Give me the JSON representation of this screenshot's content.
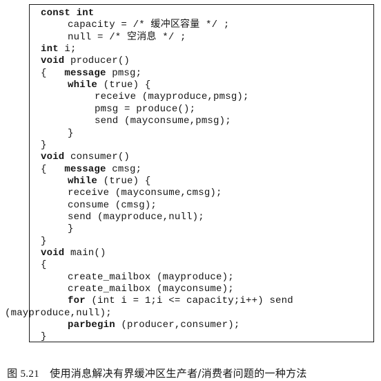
{
  "code": {
    "lines": [
      {
        "indent": 0,
        "segments": [
          {
            "text": "const int",
            "bold": true
          }
        ]
      },
      {
        "indent": 2,
        "segments": [
          {
            "text": "capacity = /* 缓冲区容量 */ ;",
            "bold": false
          }
        ]
      },
      {
        "indent": 2,
        "segments": [
          {
            "text": "null = /* 空消息 */ ;",
            "bold": false
          }
        ]
      },
      {
        "indent": 0,
        "segments": [
          {
            "text": "int",
            "bold": true
          },
          {
            "text": " i;",
            "bold": false
          }
        ]
      },
      {
        "indent": 0,
        "segments": [
          {
            "text": "void",
            "bold": true
          },
          {
            "text": " producer()",
            "bold": false
          }
        ]
      },
      {
        "indent": 0,
        "segments": [
          {
            "text": "{   ",
            "bold": false
          },
          {
            "text": "message",
            "bold": true
          },
          {
            "text": " pmsg;",
            "bold": false
          }
        ]
      },
      {
        "indent": 2,
        "segments": [
          {
            "text": "while",
            "bold": true
          },
          {
            "text": " (true) {",
            "bold": false
          }
        ]
      },
      {
        "indent": 4,
        "segments": [
          {
            "text": "receive (mayproduce,pmsg);",
            "bold": false
          }
        ]
      },
      {
        "indent": 4,
        "segments": [
          {
            "text": "pmsg = produce();",
            "bold": false
          }
        ]
      },
      {
        "indent": 4,
        "segments": [
          {
            "text": "send (mayconsume,pmsg);",
            "bold": false
          }
        ]
      },
      {
        "indent": 2,
        "segments": [
          {
            "text": "}",
            "bold": false
          }
        ]
      },
      {
        "indent": 0,
        "segments": [
          {
            "text": "}",
            "bold": false
          }
        ]
      },
      {
        "indent": 0,
        "segments": [
          {
            "text": "void",
            "bold": true
          },
          {
            "text": " consumer()",
            "bold": false
          }
        ]
      },
      {
        "indent": 0,
        "segments": [
          {
            "text": "{   ",
            "bold": false
          },
          {
            "text": "message",
            "bold": true
          },
          {
            "text": " cmsg;",
            "bold": false
          }
        ]
      },
      {
        "indent": 2,
        "segments": [
          {
            "text": "while",
            "bold": true
          },
          {
            "text": " (true) {",
            "bold": false
          }
        ]
      },
      {
        "indent": 2,
        "segments": [
          {
            "text": "receive (mayconsume,cmsg);",
            "bold": false
          }
        ]
      },
      {
        "indent": 2,
        "segments": [
          {
            "text": "consume (cmsg);",
            "bold": false
          }
        ]
      },
      {
        "indent": 2,
        "segments": [
          {
            "text": "send (mayproduce,null);",
            "bold": false
          }
        ]
      },
      {
        "indent": 2,
        "segments": [
          {
            "text": "}",
            "bold": false
          }
        ]
      },
      {
        "indent": 0,
        "segments": [
          {
            "text": "}",
            "bold": false
          }
        ]
      },
      {
        "indent": 0,
        "segments": [
          {
            "text": "void",
            "bold": true
          },
          {
            "text": " main()",
            "bold": false
          }
        ]
      },
      {
        "indent": 0,
        "segments": [
          {
            "text": "{",
            "bold": false
          }
        ]
      },
      {
        "indent": 2,
        "segments": [
          {
            "text": "create_mailbox (mayproduce);",
            "bold": false
          }
        ]
      },
      {
        "indent": 2,
        "segments": [
          {
            "text": "create_mailbox (mayconsume);",
            "bold": false
          }
        ]
      },
      {
        "indent": 2,
        "segments": [
          {
            "text": "for",
            "bold": true
          },
          {
            "text": " (int i = 1;i <= capacity;i++) send",
            "bold": false
          }
        ]
      },
      {
        "indent": -1,
        "segments": [
          {
            "text": "(mayproduce,null);",
            "bold": false
          }
        ]
      },
      {
        "indent": 2,
        "segments": [
          {
            "text": "parbegin",
            "bold": true
          },
          {
            "text": " (producer,consumer);",
            "bold": false
          }
        ]
      },
      {
        "indent": 0,
        "segments": [
          {
            "text": "}",
            "bold": false
          }
        ]
      }
    ]
  },
  "caption": {
    "figure_label": "图 5.21",
    "text": "使用消息解决有界缓冲区生产者/消费者问题的一种方法"
  }
}
